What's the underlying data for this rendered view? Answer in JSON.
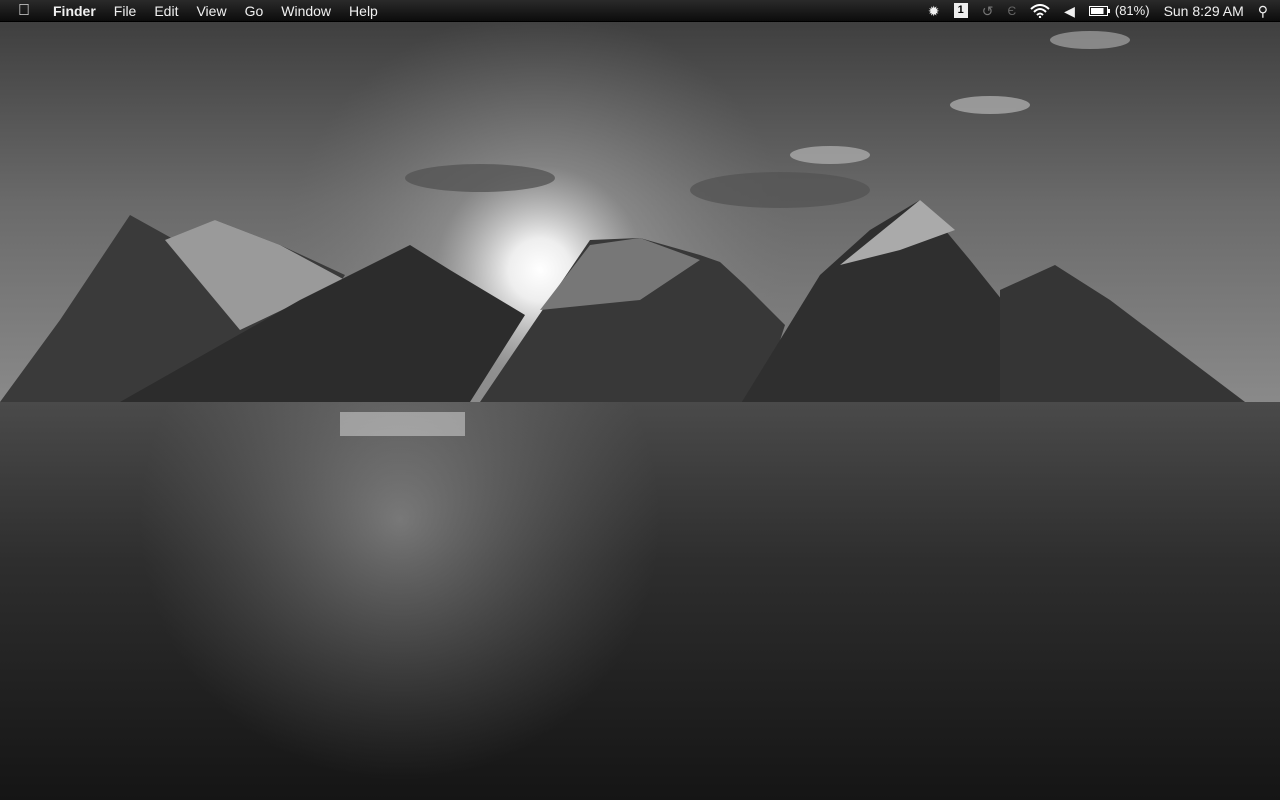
{
  "menubar": {
    "apple_icon": "apple-logo-icon",
    "app_name": "Finder",
    "menus": [
      "File",
      "Edit",
      "View",
      "Go",
      "Window",
      "Help"
    ],
    "status": {
      "icons": [
        "gear-sun-icon",
        "spaces-icon",
        "time-machine-icon",
        "bluetooth-icon",
        "wifi-icon",
        "volume-icon",
        "battery-icon",
        "spotlight-search-icon"
      ],
      "spaces_number": "1",
      "battery_percent": "(81%)",
      "battery_level": 0.81,
      "clock": "Sun 8:29 AM"
    }
  },
  "desktop": {
    "wallpaper": "grayscale mountains over sea at sunset"
  }
}
